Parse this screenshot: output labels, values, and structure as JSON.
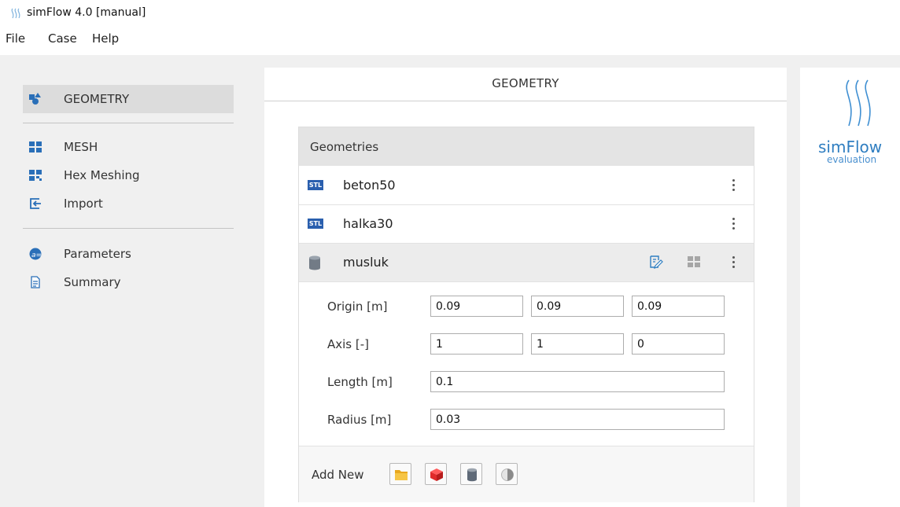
{
  "window": {
    "title": "simFlow 4.0 [manual]"
  },
  "menu": [
    "File",
    "Case",
    "Help"
  ],
  "sidebar": {
    "items": [
      {
        "label": "GEOMETRY",
        "icon": "shapes-icon",
        "active": true
      },
      {
        "label": "MESH",
        "icon": "mesh-grid-icon"
      },
      {
        "label": "Hex Meshing",
        "icon": "hex-mesh-icon"
      },
      {
        "label": "Import",
        "icon": "import-icon"
      },
      {
        "label": "Parameters",
        "icon": "parameters-icon"
      },
      {
        "label": "Summary",
        "icon": "document-icon"
      }
    ]
  },
  "center": {
    "title": "GEOMETRY"
  },
  "geometries": {
    "header": "Geometries",
    "items": [
      {
        "label": "beton50",
        "type": "STL"
      },
      {
        "label": "halka30",
        "type": "STL"
      },
      {
        "label": "musluk",
        "type": "cylinder",
        "selected": true
      }
    ],
    "properties": {
      "origin": {
        "label": "Origin [m]",
        "values": [
          "0.09",
          "0.09",
          "0.09"
        ]
      },
      "axis": {
        "label": "Axis [-]",
        "values": [
          "1",
          "1",
          "0"
        ]
      },
      "length": {
        "label": "Length [m]",
        "value": "0.1"
      },
      "radius": {
        "label": "Radius [m]",
        "value": "0.03"
      }
    },
    "add_new": {
      "label": "Add New",
      "buttons": [
        "folder-icon",
        "box-icon",
        "cylinder-icon",
        "sphere-icon"
      ]
    }
  },
  "brand": {
    "name": "simFlow",
    "sub": "evaluation"
  },
  "colors": {
    "accent": "#2f7ec1",
    "stl_badge": "#2a5fae",
    "active_bg": "#dcdcdc"
  }
}
